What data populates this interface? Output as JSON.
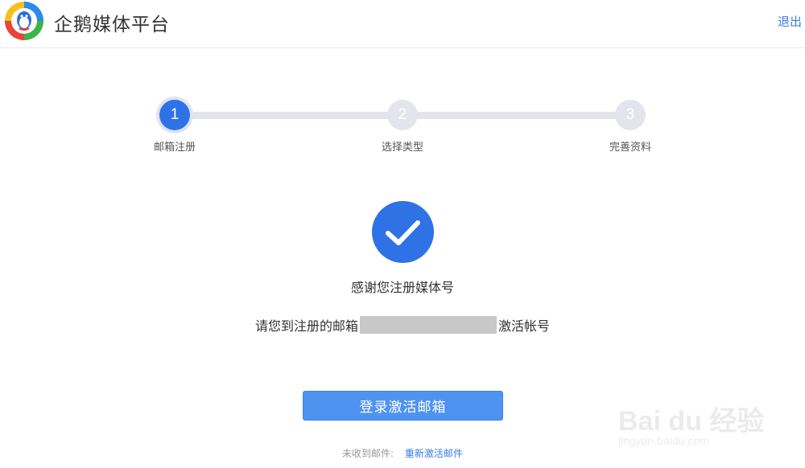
{
  "header": {
    "app_title": "企鹅媒体平台",
    "logout_label": "退出"
  },
  "stepper": {
    "steps": [
      {
        "number": "1",
        "label": "邮箱注册",
        "state": "active"
      },
      {
        "number": "2",
        "label": "选择类型",
        "state": "inactive"
      },
      {
        "number": "3",
        "label": "完善资料",
        "state": "inactive"
      }
    ]
  },
  "success": {
    "icon": "check-circle-icon",
    "thanks_text": "感谢您注册媒体号",
    "email_prefix": "请您到注册的邮箱",
    "email_suffix": "激活帐号"
  },
  "actions": {
    "login_button_label": "登录激活邮箱",
    "resend_prefix": "未收到邮件:",
    "resend_link_label": "重新激活邮件"
  },
  "watermark": {
    "brand": "Bai du 经验",
    "url": "jingyan.baidu.com"
  },
  "colors": {
    "accent": "#2f72e6",
    "button": "#4f93f0",
    "link": "#3a7be0"
  }
}
